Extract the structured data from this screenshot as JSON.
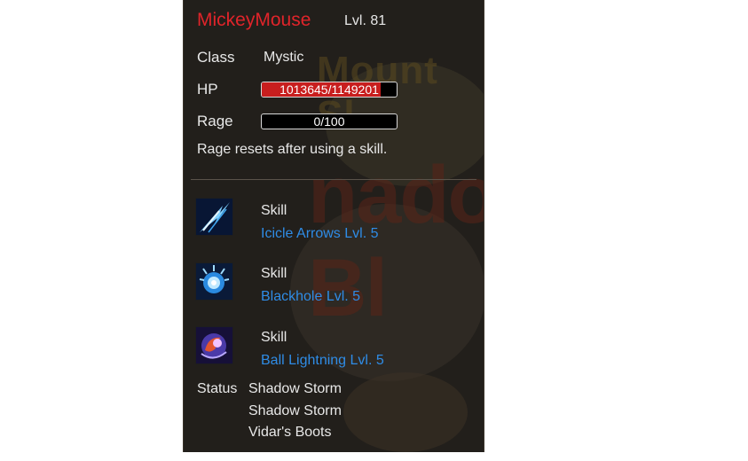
{
  "character": {
    "name": "MickeyMouse",
    "level": "Lvl. 81",
    "class_label": "Class",
    "class_value": "Mystic",
    "hp_label": "HP",
    "hp_text": "1013645/1149201",
    "hp_fraction": 0.882,
    "rage_label": "Rage",
    "rage_text": "0/100",
    "rage_fraction": 0.0,
    "rage_note": "Rage resets after using a skill."
  },
  "skills": [
    {
      "type": "Skill",
      "name": "Icicle Arrows Lvl. 5",
      "icon": "icicle-arrows-icon"
    },
    {
      "type": "Skill",
      "name": "Blackhole Lvl. 5",
      "icon": "blackhole-icon"
    },
    {
      "type": "Skill",
      "name": "Ball Lightning Lvl. 5",
      "icon": "ball-lightning-icon"
    }
  ],
  "status": {
    "label": "Status",
    "items": [
      "Shadow Storm",
      "Shadow Storm",
      "Vidar's Boots"
    ]
  },
  "background": {
    "text_1": "Mount Sl",
    "text_2": "nado Bl"
  },
  "colors": {
    "name": "#e0242a",
    "skill_name": "#2f8ce6",
    "hp_fill": "#c81e1e",
    "panel_bg": "#221f1b"
  }
}
